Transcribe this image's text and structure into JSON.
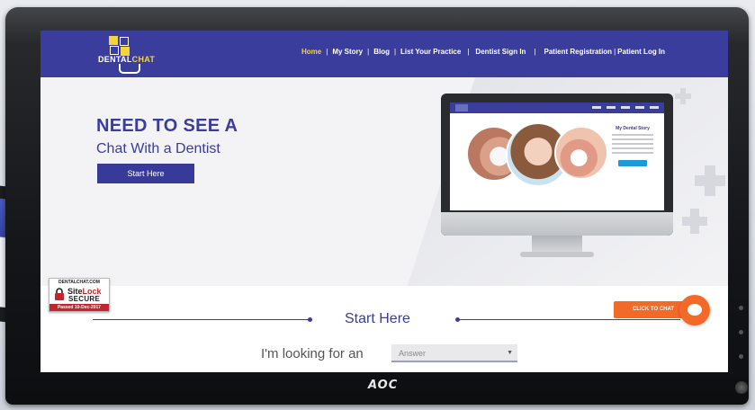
{
  "monitor": {
    "brand": "AOC"
  },
  "logo": {
    "text_dental": "DENTAL",
    "text_chat": "CHAT"
  },
  "nav": {
    "items": [
      {
        "label": "Home",
        "active": true
      },
      {
        "label": "My Story",
        "active": false
      },
      {
        "label": "Blog",
        "active": false
      },
      {
        "label": "List Your Practice",
        "active": false
      },
      {
        "label": "Dentist Sign In",
        "active": false
      },
      {
        "label": "Patient Registration",
        "active": false
      },
      {
        "label": "Patient Log In",
        "active": false
      }
    ]
  },
  "hero": {
    "title": "NEED TO SEE A",
    "subtitle": "Chat With a Dentist",
    "button_label": "Start Here"
  },
  "preview": {
    "card_title": "My Dental Story"
  },
  "sitelock": {
    "domain": "DENTALCHAT.COM",
    "name_a": "Site",
    "name_b": "Lock",
    "secure": "SECURE",
    "passed": "Passed",
    "date": "10-Dec-2017"
  },
  "start": {
    "title": "Start Here",
    "looking_label": "I'm looking for an",
    "select_value": "Answer"
  },
  "chat": {
    "button_label": "CLICK TO CHAT"
  },
  "colors": {
    "brand": "#3b3d9c",
    "accent": "#f3d43e",
    "chat": "#f36a28",
    "sitelock_red": "#c0262d"
  }
}
